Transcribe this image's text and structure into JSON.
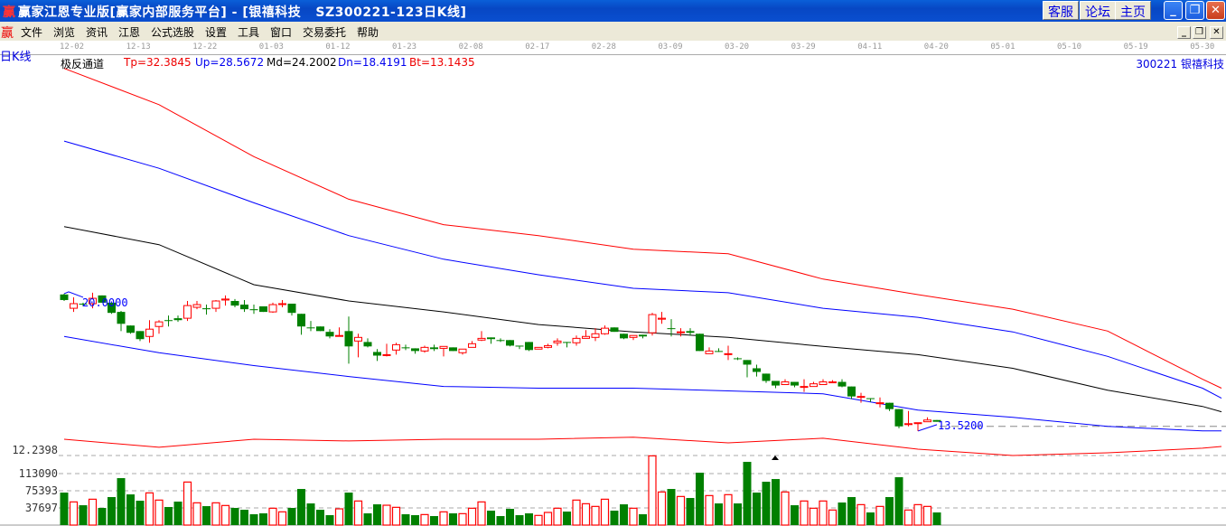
{
  "window": {
    "title": "赢家江恩专业版[赢家内部服务平台] - [银禧科技   SZ300221-123日K线]",
    "logo": "赢",
    "buttons": [
      {
        "label": "客服"
      },
      {
        "label": "论坛"
      },
      {
        "label": "主页"
      }
    ],
    "controls": {
      "minimize": "_",
      "restore": "❐",
      "close": "✕"
    }
  },
  "menu": {
    "logo": "赢",
    "items": [
      "文件",
      "浏览",
      "资讯",
      "江恩",
      "公式选股",
      "设置",
      "工具",
      "窗口",
      "交易委托",
      "帮助"
    ],
    "mdi": {
      "minimize": "_",
      "restore": "❐",
      "close": "✕"
    }
  },
  "period": "日K线",
  "dates": [
    "12-02",
    "12-13",
    "12-22",
    "01-03",
    "01-12",
    "01-23",
    "02-08",
    "02-17",
    "02-28",
    "03-09",
    "03-20",
    "03-29",
    "04-11",
    "04-20",
    "05-01",
    "05-10",
    "05-19",
    "05-30"
  ],
  "indicator": {
    "name": "极反通道",
    "tp": "Tp=32.3845",
    "up": "Up=28.5672",
    "md": "Md=24.2002",
    "dn": "Dn=18.4191",
    "bt": "Bt=13.1435"
  },
  "stock": "300221  银禧科技",
  "markers": {
    "high_label": "20.0000",
    "low_label": "13.5200"
  },
  "axis": {
    "price_label": "12.2398",
    "vol_labels": [
      "113090",
      "75393",
      "37697"
    ]
  },
  "colors": {
    "up": "#ff0000",
    "down": "#008000",
    "tp": "#ff0000",
    "upper": "#0000ff",
    "mid": "#000000",
    "lower": "#0000ff",
    "bt": "#ff0000"
  },
  "chart_data": {
    "type": "candlestick",
    "price_range": [
      12.24,
      33.17
    ],
    "volume_max": 152770,
    "candles": [
      [
        20.64,
        20.68,
        20.3,
        20.35,
        0
      ],
      [
        19.92,
        20.49,
        19.73,
        20.16,
        1
      ],
      [
        20.16,
        20.21,
        20.02,
        20.16,
        0
      ],
      [
        20.16,
        20.73,
        19.92,
        20.44,
        1
      ],
      [
        20.59,
        20.59,
        20.21,
        20.21,
        0
      ],
      [
        20.21,
        20.21,
        19.63,
        19.68,
        0
      ],
      [
        19.73,
        19.78,
        18.73,
        19.11,
        0
      ],
      [
        19.02,
        19.02,
        18.59,
        18.64,
        0
      ],
      [
        18.73,
        18.73,
        18.21,
        18.31,
        0
      ],
      [
        18.45,
        19.3,
        18.12,
        18.83,
        1
      ],
      [
        18.97,
        19.3,
        18.59,
        19.21,
        1
      ],
      [
        19.3,
        19.54,
        18.97,
        19.3,
        0
      ],
      [
        19.4,
        19.54,
        19.21,
        19.3,
        0
      ],
      [
        19.4,
        20.3,
        19.26,
        20.06,
        1
      ],
      [
        19.97,
        20.3,
        19.87,
        20.11,
        1
      ],
      [
        19.92,
        20.11,
        19.59,
        19.87,
        0
      ],
      [
        19.92,
        20.35,
        19.73,
        20.3,
        1
      ],
      [
        20.35,
        20.59,
        20.06,
        20.4,
        1
      ],
      [
        20.3,
        20.4,
        19.97,
        20.06,
        0
      ],
      [
        20.11,
        20.35,
        19.73,
        19.87,
        0
      ],
      [
        19.87,
        20.11,
        19.63,
        19.82,
        0
      ],
      [
        20.02,
        20.02,
        19.73,
        19.73,
        0
      ],
      [
        19.73,
        20.21,
        19.68,
        20.11,
        1
      ],
      [
        20.16,
        20.35,
        19.97,
        20.16,
        1
      ],
      [
        20.16,
        20.16,
        19.54,
        19.68,
        0
      ],
      [
        19.63,
        19.63,
        18.54,
        18.97,
        0
      ],
      [
        18.92,
        19.26,
        18.73,
        18.92,
        0
      ],
      [
        18.97,
        18.97,
        18.73,
        18.73,
        0
      ],
      [
        18.69,
        18.83,
        18.35,
        18.45,
        0
      ],
      [
        18.5,
        18.92,
        18.45,
        18.5,
        1
      ],
      [
        18.73,
        19.49,
        17.03,
        17.93,
        0
      ],
      [
        18.21,
        18.59,
        17.36,
        18.4,
        1
      ],
      [
        18.16,
        18.35,
        17.88,
        17.93,
        0
      ],
      [
        17.64,
        17.79,
        17.17,
        17.45,
        0
      ],
      [
        17.5,
        18.07,
        17.41,
        17.5,
        1
      ],
      [
        17.74,
        18.12,
        17.5,
        18.02,
        1
      ],
      [
        17.88,
        18.02,
        17.74,
        17.88,
        0
      ],
      [
        17.83,
        17.83,
        17.55,
        17.69,
        0
      ],
      [
        17.69,
        17.97,
        17.6,
        17.88,
        1
      ],
      [
        17.88,
        18.02,
        17.69,
        17.79,
        0
      ],
      [
        17.83,
        17.93,
        17.41,
        17.93,
        1
      ],
      [
        17.88,
        17.88,
        17.69,
        17.69,
        0
      ],
      [
        17.6,
        17.79,
        17.5,
        17.79,
        1
      ],
      [
        17.88,
        18.21,
        17.88,
        18.07,
        1
      ],
      [
        18.26,
        18.73,
        18.21,
        18.35,
        1
      ],
      [
        18.4,
        18.4,
        18.07,
        18.31,
        0
      ],
      [
        18.26,
        18.35,
        18.16,
        18.26,
        0
      ],
      [
        18.26,
        18.26,
        17.93,
        17.97,
        0
      ],
      [
        17.97,
        17.97,
        17.79,
        17.97,
        0
      ],
      [
        18.16,
        18.16,
        17.69,
        17.74,
        0
      ],
      [
        17.79,
        17.88,
        17.79,
        17.88,
        1
      ],
      [
        17.88,
        18.07,
        17.83,
        17.97,
        1
      ],
      [
        18.12,
        18.35,
        17.97,
        18.21,
        1
      ],
      [
        18.16,
        18.16,
        17.88,
        18.12,
        0
      ],
      [
        18.12,
        18.5,
        17.97,
        18.35,
        1
      ],
      [
        18.35,
        18.78,
        18.35,
        18.45,
        1
      ],
      [
        18.4,
        18.88,
        18.21,
        18.59,
        1
      ],
      [
        18.59,
        19.02,
        18.54,
        18.88,
        1
      ],
      [
        18.92,
        18.92,
        18.69,
        18.69,
        0
      ],
      [
        18.59,
        18.59,
        18.31,
        18.35,
        0
      ],
      [
        18.4,
        18.5,
        18.26,
        18.5,
        1
      ],
      [
        18.54,
        18.54,
        18.35,
        18.45,
        0
      ],
      [
        18.64,
        19.68,
        18.5,
        19.59,
        1
      ],
      [
        19.35,
        19.73,
        19.11,
        19.4,
        1
      ],
      [
        18.88,
        19.35,
        18.45,
        18.88,
        0
      ],
      [
        18.69,
        18.88,
        18.45,
        18.69,
        1
      ],
      [
        18.73,
        18.88,
        18.5,
        18.64,
        0
      ],
      [
        18.59,
        18.59,
        17.69,
        17.69,
        0
      ],
      [
        17.55,
        17.88,
        17.55,
        17.69,
        1
      ],
      [
        17.69,
        17.83,
        17.64,
        17.69,
        0
      ],
      [
        17.55,
        17.97,
        17.22,
        17.55,
        1
      ],
      [
        17.31,
        17.36,
        17.22,
        17.31,
        0
      ],
      [
        17.22,
        17.22,
        16.32,
        16.98,
        0
      ],
      [
        16.79,
        16.98,
        16.36,
        16.6,
        0
      ],
      [
        16.51,
        16.51,
        16.03,
        16.13,
        0
      ],
      [
        16.13,
        16.13,
        15.75,
        15.89,
        0
      ],
      [
        15.94,
        16.22,
        15.94,
        16.08,
        1
      ],
      [
        16.08,
        16.08,
        15.8,
        15.89,
        0
      ],
      [
        15.84,
        16.22,
        15.56,
        15.84,
        1
      ],
      [
        15.84,
        16.08,
        15.84,
        15.98,
        1
      ],
      [
        15.94,
        16.22,
        15.94,
        16.08,
        1
      ],
      [
        16.08,
        16.17,
        16.03,
        16.08,
        1
      ],
      [
        16.08,
        16.22,
        15.8,
        15.84,
        0
      ],
      [
        15.84,
        15.84,
        15.18,
        15.32,
        0
      ],
      [
        15.32,
        15.51,
        14.99,
        15.32,
        1
      ],
      [
        15.23,
        15.23,
        15.04,
        15.23,
        0
      ],
      [
        14.99,
        15.27,
        14.75,
        14.99,
        1
      ],
      [
        14.99,
        14.99,
        14.56,
        14.66,
        0
      ],
      [
        14.66,
        14.66,
        13.66,
        13.76,
        0
      ],
      [
        13.9,
        14.56,
        13.76,
        13.9,
        1
      ],
      [
        13.95,
        13.95,
        13.52,
        13.95,
        1
      ],
      [
        14.0,
        14.23,
        14.0,
        14.09,
        1
      ],
      [
        14.09,
        14.09,
        14.0,
        14.0,
        0
      ]
    ],
    "volumes": [
      71400,
      50900,
      43600,
      56800,
      37700,
      61500,
      103100,
      67400,
      53500,
      70700,
      54900,
      39700,
      51600,
      94500,
      48900,
      41600,
      48900,
      43000,
      37700,
      33700,
      23800,
      25800,
      37000,
      29100,
      37700,
      79300,
      47600,
      33700,
      21800,
      35700,
      71400,
      52900,
      25800,
      45600,
      43600,
      39000,
      23800,
      21800,
      23100,
      19800,
      29100,
      25800,
      25100,
      37000,
      50900,
      31700,
      19800,
      35700,
      21800,
      25800,
      21200,
      27800,
      37000,
      29700,
      54900,
      46900,
      41000,
      56800,
      31700,
      45600,
      37000,
      23800,
      152000,
      72700,
      79300,
      62800,
      59500,
      115000,
      64800,
      47600,
      66800,
      47600,
      138800,
      71400,
      95200,
      101100,
      72700,
      43600,
      52900,
      37000,
      52900,
      33100,
      49600,
      61500,
      44900,
      27800,
      41000,
      61500,
      105100,
      33100,
      44900,
      41000,
      27800
    ],
    "band_sample_index": [
      0,
      10,
      20,
      30,
      40,
      50,
      60,
      70,
      80,
      90,
      100,
      110,
      120,
      122
    ],
    "bands": {
      "tp": [
        32.43,
        30.54,
        27.83,
        25.61,
        24.28,
        23.71,
        23.0,
        22.76,
        21.44,
        20.63,
        19.87,
        18.73,
        16.22,
        15.75
      ],
      "up": [
        28.64,
        27.22,
        25.42,
        23.71,
        22.48,
        21.67,
        20.96,
        20.73,
        19.92,
        19.45,
        18.69,
        17.41,
        15.75,
        15.23
      ],
      "md": [
        24.18,
        23.24,
        21.15,
        20.3,
        19.73,
        19.07,
        18.69,
        18.4,
        17.93,
        17.5,
        16.79,
        15.65,
        14.8,
        14.52
      ],
      "dn": [
        18.45,
        17.6,
        16.93,
        16.36,
        15.84,
        15.75,
        15.75,
        15.61,
        15.46,
        14.61,
        14.23,
        13.76,
        13.52,
        13.52
      ],
      "bt": [
        13.09,
        12.67,
        13.09,
        13.0,
        13.09,
        13.09,
        13.19,
        12.9,
        13.14,
        12.57,
        12.24,
        12.38,
        12.62,
        12.71
      ]
    },
    "last_price_line": 13.76,
    "vol_grid": [
      37697,
      75393,
      113090
    ]
  }
}
